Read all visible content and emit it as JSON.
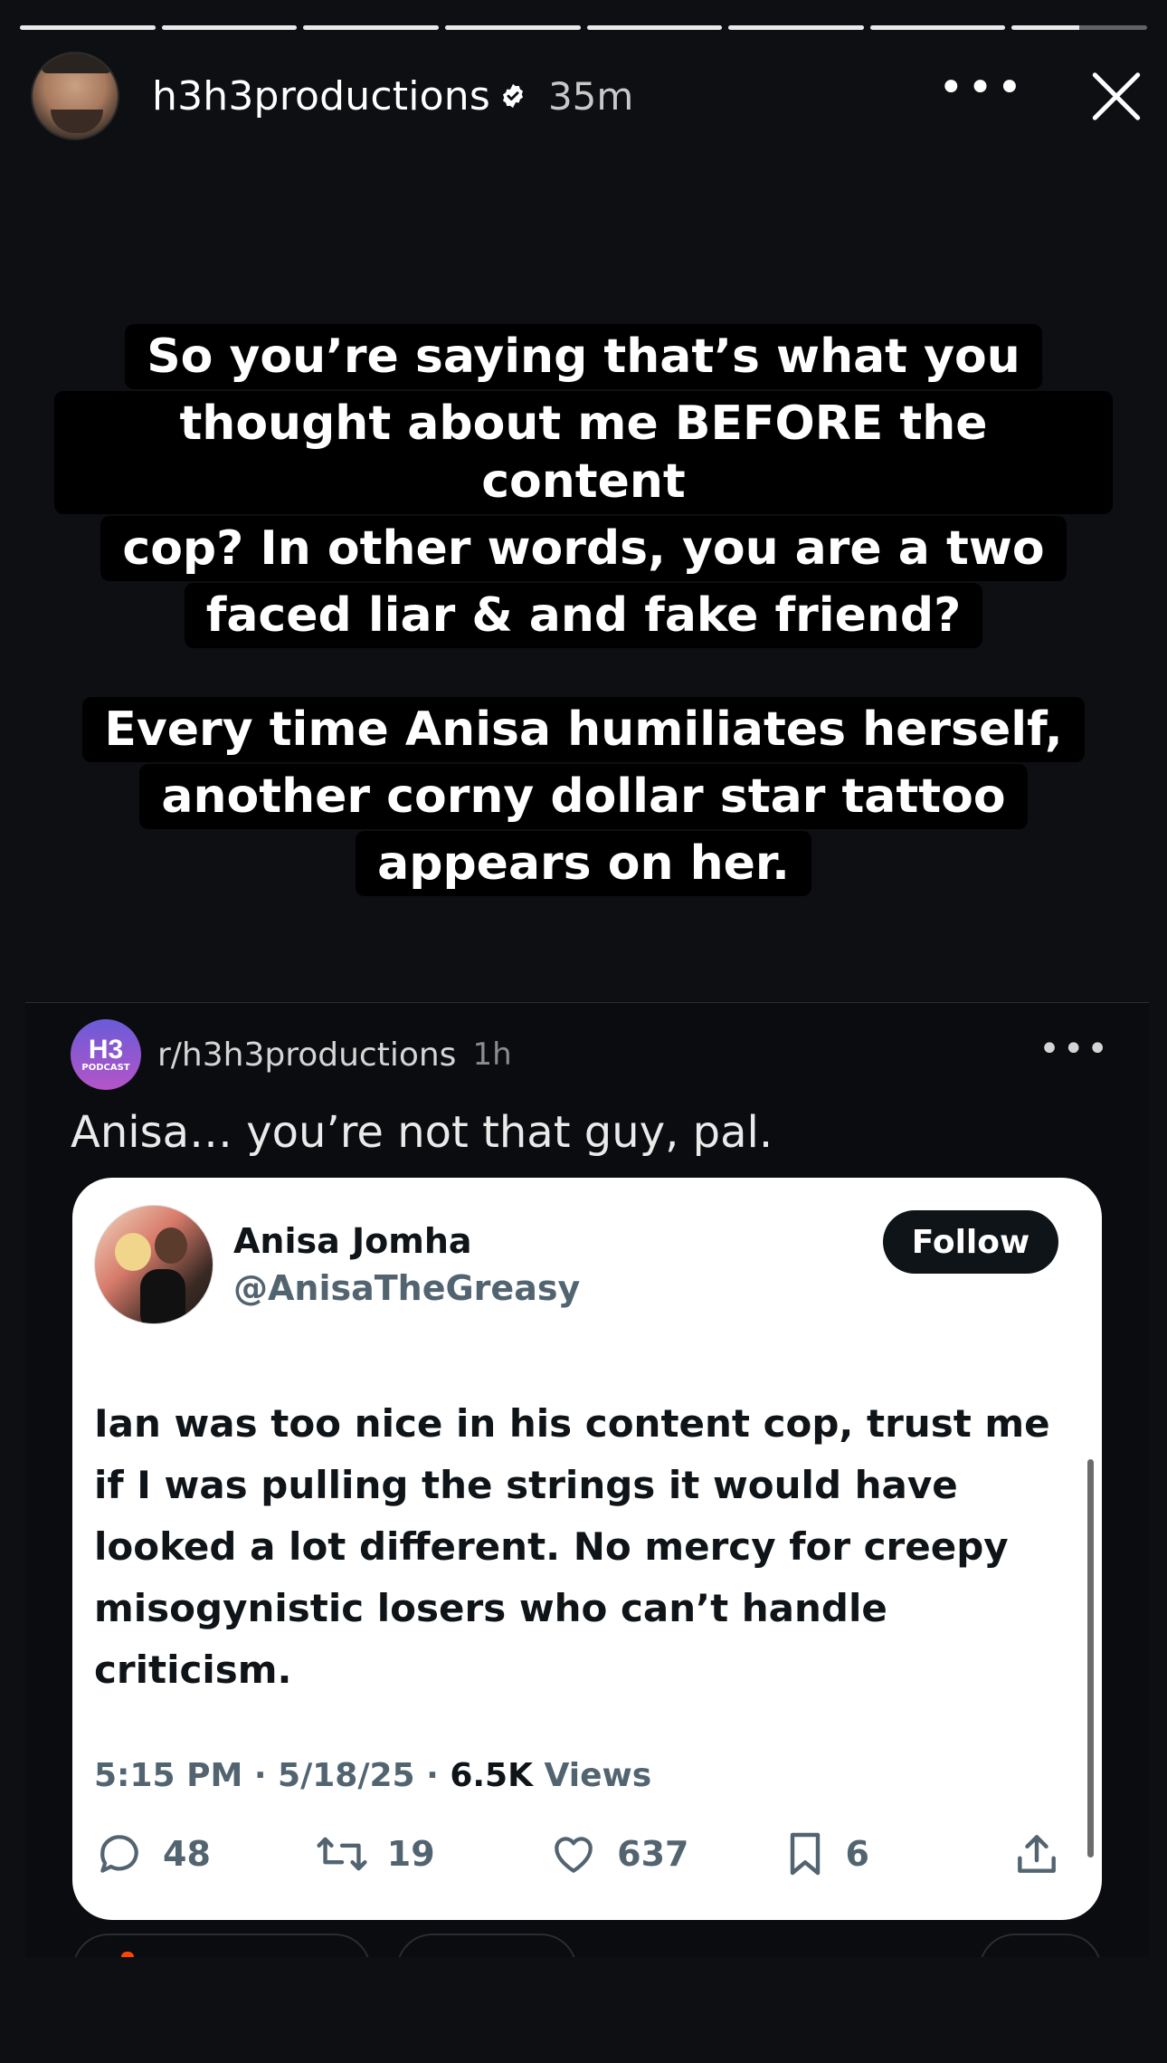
{
  "story": {
    "segments_total": 8,
    "segments_completed": 7,
    "current_segment_progress": 0.5
  },
  "header": {
    "username": "h3h3productions",
    "time": "35m",
    "more_icon": "more-horizontal-icon",
    "close_icon": "close-icon",
    "verified_icon": "verified-badge-icon"
  },
  "caption": {
    "paragraph1": [
      "So you’re saying that’s what you",
      "thought about me BEFORE the content",
      "cop? In other words, you are a two",
      "faced liar & and fake friend?"
    ],
    "paragraph2": [
      "Every time Anisa humiliates herself,",
      "another corny dollar star tattoo",
      "appears on her."
    ]
  },
  "reddit_post": {
    "subreddit": "r/h3h3productions",
    "subreddit_icon_text": "H3",
    "subreddit_icon_small": "PODCAST",
    "time": "1h",
    "title": "Anisa… you’re not that guy, pal.",
    "more_icon": "more-horizontal-icon"
  },
  "tweet": {
    "display_name": "Anisa Jomha",
    "handle": "@AnisaTheGreasy",
    "follow_label": "Follow",
    "body": "Ian was too nice in his content cop, trust me if I was pulling the strings it would have looked a lot different. No mercy for creepy misogynistic losers who can’t handle criticism.",
    "timestamp": "5:15 PM · 5/18/25 · ",
    "views_count": "6.5K",
    "views_label": " Views",
    "actions": {
      "replies": "48",
      "retweets": "19",
      "likes": "637",
      "bookmarks": "6"
    }
  },
  "colors": {
    "background": "#0d0f13",
    "caption_box": "#000000",
    "tweet_card": "#ffffff",
    "follow_button": "#0f1419",
    "muted": "#536471"
  }
}
